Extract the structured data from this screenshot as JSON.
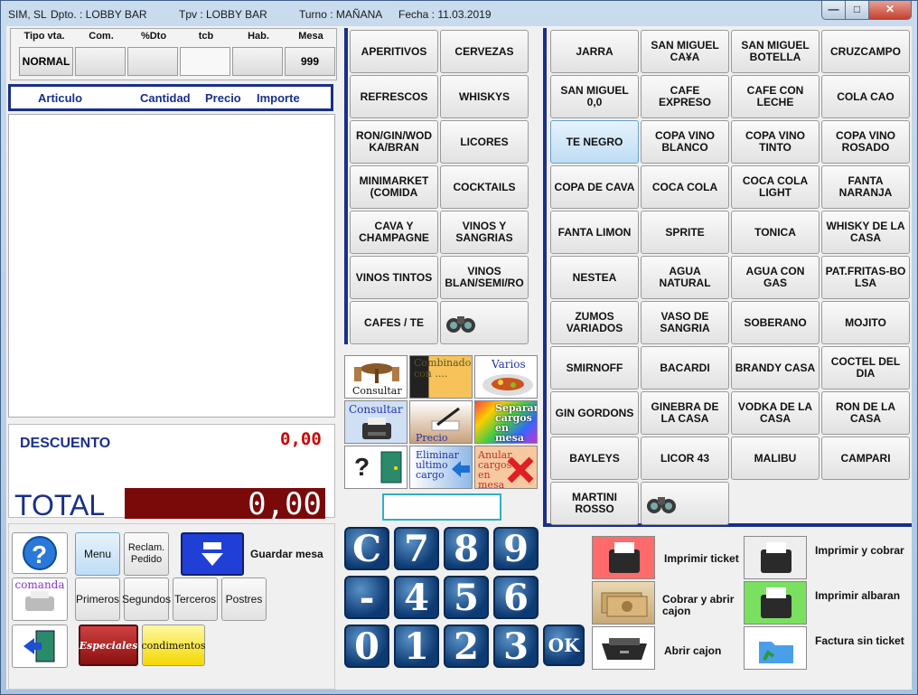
{
  "titlebar": {
    "company": "SIM, SL",
    "dpto": "Dpto. : LOBBY BAR",
    "tpv": "Tpv : LOBBY BAR",
    "turno": "Turno : MAÑANA",
    "fecha": "Fecha : 11.03.2019"
  },
  "header": {
    "tipo_label": "Tipo vta.",
    "com_label": "Com.",
    "dto_label": "%Dto",
    "tcb_label": "tcb",
    "hab_label": "Hab.",
    "mesa_label": "Mesa",
    "tipo_value": "NORMAL",
    "mesa_value": "999"
  },
  "ticket": {
    "col_articulo": "Articulo",
    "col_cantidad": "Cantidad",
    "col_precio": "Precio",
    "col_importe": "Importe"
  },
  "totals": {
    "descuento_label": "DESCUENTO",
    "descuento_value": "0,00",
    "total_label": "TOTAL",
    "total_value": "0,00"
  },
  "categories": [
    "APERITIVOS",
    "CERVEZAS",
    "REFRESCOS",
    "WHISKYS",
    "RON/GIN/WOD KA/BRAN",
    "LICORES",
    "MINIMARKET (COMIDA",
    "COCKTAILS",
    "CAVA Y CHAMPAGNE",
    "VINOS Y SANGRIAS",
    "VINOS TINTOS",
    "VINOS BLAN/SEMI/RO",
    "CAFES / TE"
  ],
  "products": [
    "JARRA",
    "SAN MIGUEL CA¥A",
    "SAN MIGUEL BOTELLA",
    "CRUZCAMPO",
    "SAN MIGUEL 0,0",
    "CAFE EXPRESO",
    "CAFE CON LECHE",
    "COLA CAO",
    "TE NEGRO",
    "COPA VINO BLANCO",
    "COPA VINO TINTO",
    "COPA VINO ROSADO",
    "COPA DE CAVA",
    "COCA COLA",
    "COCA COLA LIGHT",
    "FANTA NARANJA",
    "FANTA LIMON",
    "SPRITE",
    "TONICA",
    "WHISKY DE LA CASA",
    "NESTEA",
    "AGUA NATURAL",
    "AGUA CON GAS",
    "PAT.FRITAS-BO LSA",
    "ZUMOS VARIADOS",
    "VASO DE SANGRIA",
    "SOBERANO",
    "MOJITO",
    "SMIRNOFF",
    "BACARDI",
    "BRANDY CASA",
    "COCTEL DEL DIA",
    "GIN GORDONS",
    "GINEBRA DE LA CASA",
    "VODKA DE LA CASA",
    "RON DE LA CASA",
    "BAYLEYS",
    "LICOR 43",
    "MALIBU",
    "CAMPARI",
    "MARTINI ROSSO"
  ],
  "actions": {
    "consultar": "Consultar",
    "combinado": "Combinado con ....",
    "varios": "Varios",
    "consultar2": "Consultar",
    "precio": "Precio",
    "separar": "Separar cargos en mesa",
    "eliminar": "Eliminar ultimo cargo",
    "anular": "Anular cargos en mesa"
  },
  "bottom_left": {
    "menu": "Menu",
    "reclam": "Reclam. Pedido",
    "guardar": "Guardar mesa",
    "comanda": "comanda",
    "primeros": "Primeros",
    "segundos": "Segundos",
    "terceros": "Terceros",
    "postres": "Postres",
    "especiales": "Especiales",
    "condimentos": "condimentos"
  },
  "keypad": {
    "keys": [
      "C",
      "7",
      "8",
      "9",
      "-",
      "4",
      "5",
      "6",
      "0",
      "1",
      "2",
      "3"
    ],
    "ok": "OK"
  },
  "print": {
    "imprimir_ticket": "Imprimir ticket",
    "imprimir_cobrar": "Imprimir y cobrar",
    "cobrar_abrir": "Cobrar y abrir cajon",
    "imprimir_albaran": "Imprimir albaran",
    "abrir_cajon": "Abrir cajon",
    "factura": "Factura sin ticket"
  },
  "colors": {
    "accent": "#1a2f8a",
    "red_value": "#cc0000",
    "total_bar": "#7a0a0a",
    "selected": "#cfe6f8"
  }
}
